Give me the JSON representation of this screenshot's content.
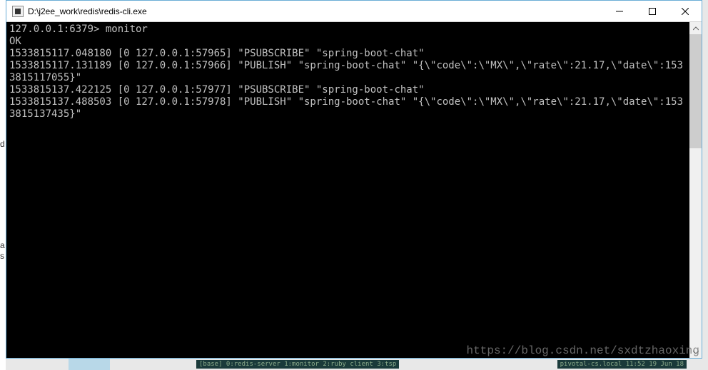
{
  "window": {
    "title": "D:\\j2ee_work\\redis\\redis-cli.exe"
  },
  "terminal": {
    "prompt": "127.0.0.1:6379> ",
    "command": "monitor",
    "response": "OK",
    "lines": [
      "1533815117.048180 [0 127.0.0.1:57965] \"PSUBSCRIBE\" \"spring-boot-chat\"",
      "1533815117.131189 [0 127.0.0.1:57966] \"PUBLISH\" \"spring-boot-chat\" \"{\\\"code\\\":\\\"MX\\\",\\\"rate\\\":21.17,\\\"date\\\":1533815117055}\"",
      "1533815137.422125 [0 127.0.0.1:57977] \"PSUBSCRIBE\" \"spring-boot-chat\"",
      "1533815137.488503 [0 127.0.0.1:57978] \"PUBLISH\" \"spring-boot-chat\" \"{\\\"code\\\":\\\"MX\\\",\\\"rate\\\":21.17,\\\"date\\\":1533815137435}\""
    ]
  },
  "left_fragments": {
    "d": "d",
    "a": "a",
    "s": "s"
  },
  "watermark": "https://blog.csdn.net/sxdtzhaoxing",
  "bottom": {
    "text1": "[base] 0:redis-server  1:monitor  2:ruby client  3:tsp",
    "text2": "pivotal-cs.local  11:52 19 Jun 18"
  }
}
